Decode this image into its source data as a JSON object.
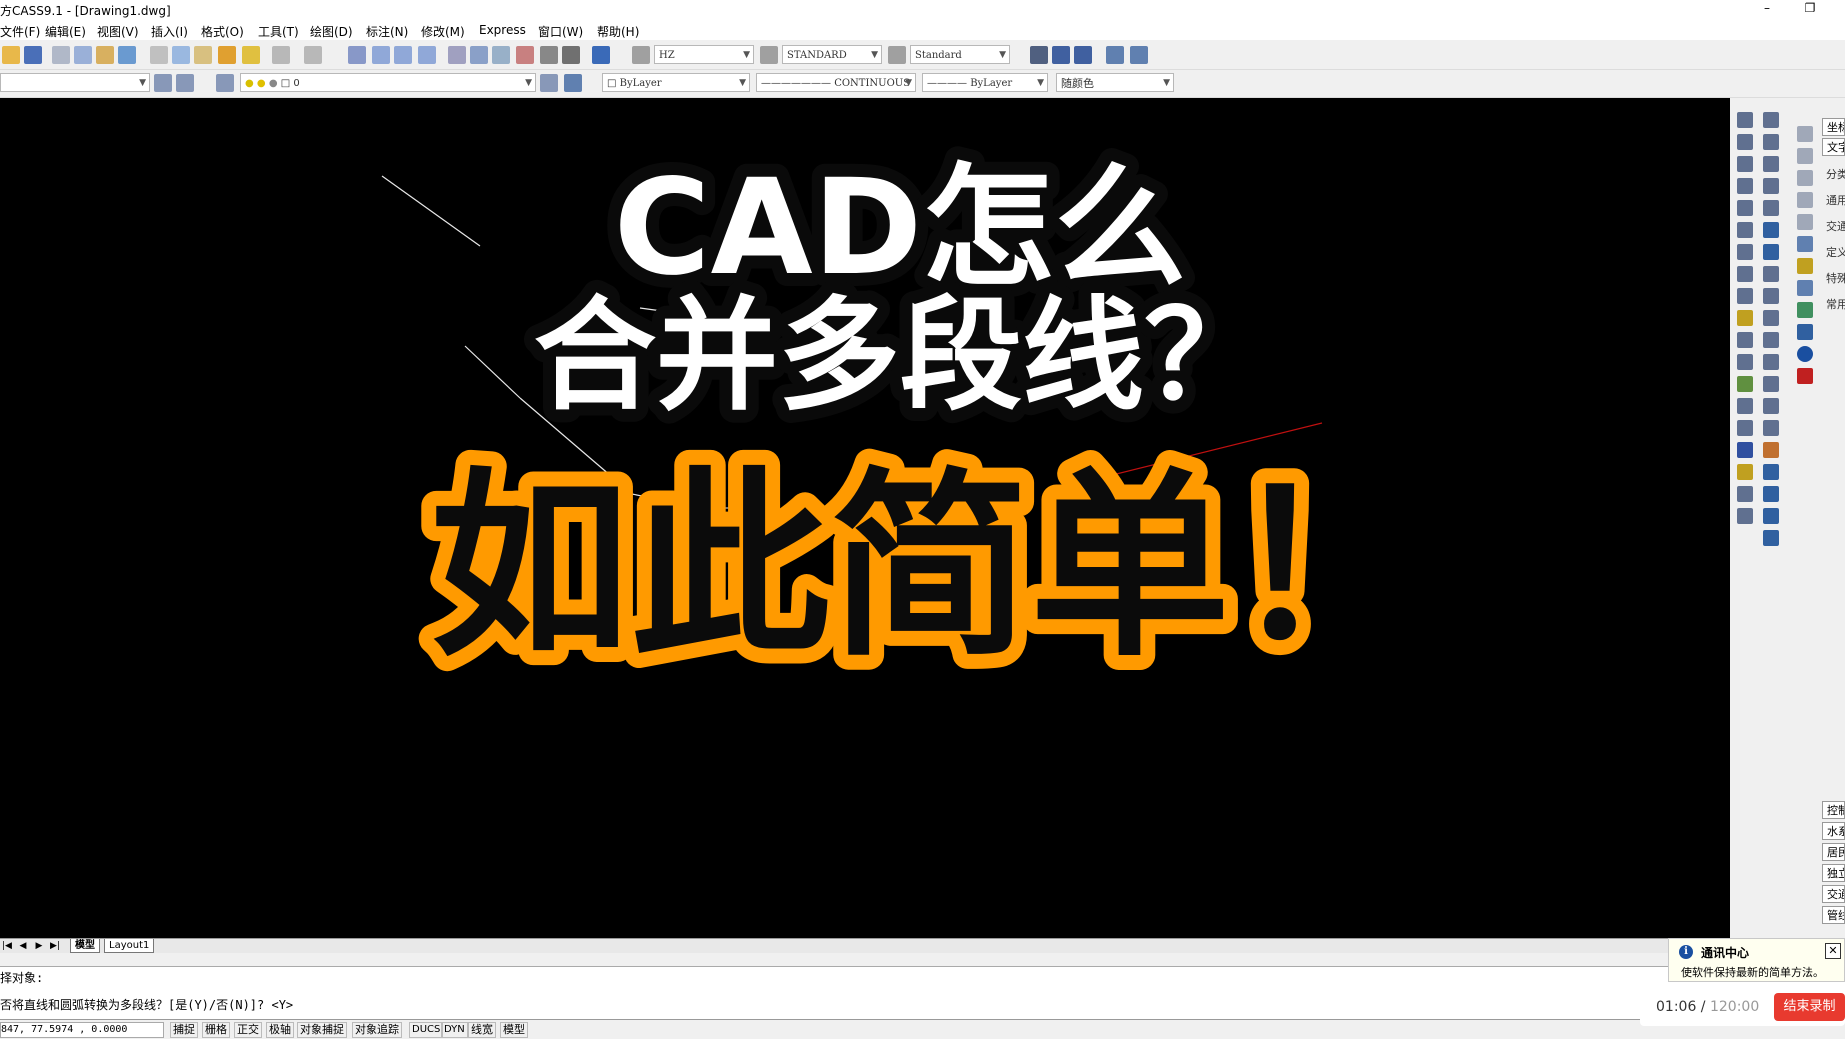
{
  "window": {
    "title": "方CASS9.1 - [Drawing1.dwg]",
    "minimize": "–",
    "restore": "❐"
  },
  "menu": [
    "文件(F)",
    "编辑(E)",
    "视图(V)",
    "插入(I)",
    "格式(O)",
    "工具(T)",
    "绘图(D)",
    "标注(N)",
    "修改(M)",
    "Express",
    "窗口(W)",
    "帮助(H)"
  ],
  "toolbar": {
    "text_style": "HZ",
    "dim_style": "STANDARD",
    "table_style": "Standard",
    "layer": "0",
    "color": "ByLayer",
    "linetype": "CONTINUOUS",
    "lineweight": "ByLayer",
    "plot_style": "随颜色"
  },
  "overlay": {
    "headline_line1": "CAD怎么",
    "headline_line2": "合并多段线？",
    "tagline": "如此简单！"
  },
  "layout_tabs": [
    "模型",
    "Layout1"
  ],
  "command": {
    "line1": "择对象:",
    "line2": "否将直线和圆弧转换为多段线？[是(Y)/否(N)]? <Y>"
  },
  "status": {
    "coords": "847, 77.5974 , 0.0000",
    "buttons": [
      "捕捉",
      "栅格",
      "正交",
      "极轴",
      "对象捕捉",
      "对象追踪",
      "DUCS",
      "DYN",
      "线宽",
      "模型"
    ]
  },
  "right_panel": {
    "top_tabs": [
      "坐标",
      "文字"
    ],
    "labels": [
      "分类",
      "通用",
      "交通",
      "定义",
      "特殊",
      "常用"
    ],
    "bottom_tabs": [
      "控制",
      "水系",
      "居民",
      "独立",
      "交通",
      "管线"
    ]
  },
  "notification": {
    "title": "通讯中心",
    "message": "使软件保持最新的简单方法。",
    "close": "✕"
  },
  "recorder": {
    "elapsed": "01:06",
    "total": "120:00",
    "separator": " / ",
    "stop_label": "结束录制"
  },
  "colors": {
    "canvas": "#000000",
    "tagline_outline": "#ff9a00",
    "stop_button": "#e83a2f"
  }
}
